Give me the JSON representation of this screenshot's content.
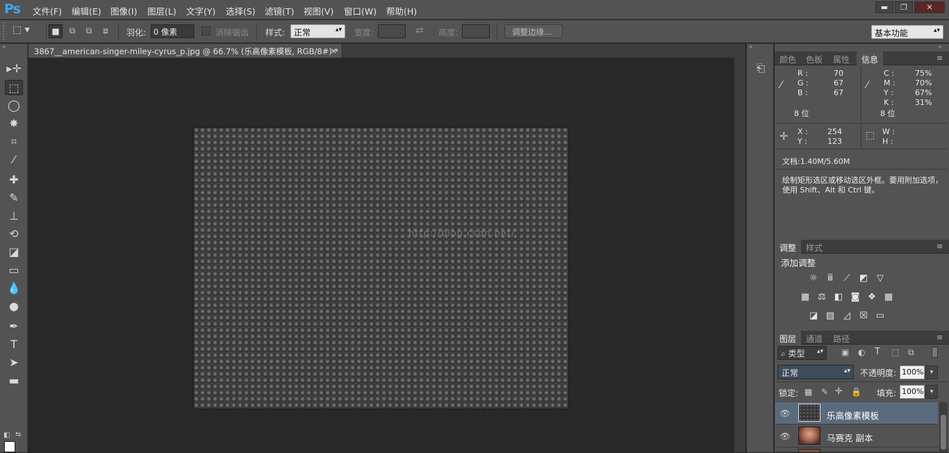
{
  "app": {
    "logo": "Ps",
    "menus": [
      "文件(F)",
      "编辑(E)",
      "图像(I)",
      "图层(L)",
      "文字(Y)",
      "选择(S)",
      "滤镜(T)",
      "视图(V)",
      "窗口(W)",
      "帮助(H)"
    ],
    "window_controls": {
      "minimize": "▬",
      "restore": "❐",
      "close": "✕"
    }
  },
  "options": {
    "feather_label": "羽化:",
    "feather_value": "0 像素",
    "antialias_label": "消除锯齿",
    "style_label": "样式:",
    "style_value": "正常",
    "width_label": "宽度:",
    "height_label": "高度:",
    "refine_edge": "调整边缘...",
    "workspace": "基本功能"
  },
  "document": {
    "tab_title": "3867__american-singer-miley-cyrus_p.jpg @ 66.7% (乐高像素模板, RGB/8#) *",
    "tab_close": "×",
    "watermark": "http://blog.csdn.net/"
  },
  "tools": [
    {
      "name": "move-tool-icon",
      "glyph": "▸✛"
    },
    {
      "name": "rect-marquee-tool-icon",
      "glyph": "⬚"
    },
    {
      "name": "lasso-tool-icon",
      "glyph": "◯"
    },
    {
      "name": "magic-wand-tool-icon",
      "glyph": "✸"
    },
    {
      "name": "crop-tool-icon",
      "glyph": "⌗"
    },
    {
      "name": "eyedropper-tool-icon",
      "glyph": "⁄"
    },
    {
      "name": "healing-brush-tool-icon",
      "glyph": "✚"
    },
    {
      "name": "brush-tool-icon",
      "glyph": "✎"
    },
    {
      "name": "clone-stamp-tool-icon",
      "glyph": "⊥"
    },
    {
      "name": "history-brush-tool-icon",
      "glyph": "⟲"
    },
    {
      "name": "eraser-tool-icon",
      "glyph": "◪"
    },
    {
      "name": "gradient-tool-icon",
      "glyph": "▭"
    },
    {
      "name": "blur-tool-icon",
      "glyph": "💧"
    },
    {
      "name": "dodge-tool-icon",
      "glyph": "●"
    },
    {
      "name": "pen-tool-icon",
      "glyph": "✒"
    },
    {
      "name": "type-tool-icon",
      "glyph": "T"
    },
    {
      "name": "path-selection-tool-icon",
      "glyph": "➤"
    },
    {
      "name": "shape-tool-icon",
      "glyph": "▬"
    },
    {
      "name": "hand-tool-icon",
      "glyph": "✋"
    },
    {
      "name": "zoom-tool-icon",
      "glyph": "🔍"
    }
  ],
  "info_panel": {
    "tabs": [
      "颜色",
      "色板",
      "属性",
      "信息"
    ],
    "rgb": {
      "R": "70",
      "G": "67",
      "B": "67"
    },
    "cmyk": {
      "C": "75%",
      "M": "70%",
      "Y": "67%",
      "K": "31%"
    },
    "bit_left": "8 位",
    "bit_right": "8 位",
    "x": "254",
    "y": "123",
    "w": "",
    "h": "",
    "doc": "文档:1.40M/5.60M",
    "hint": "绘制矩形选区或移动选区外框。要用附加选项，使用 Shift、Alt 和 Ctrl 键。"
  },
  "adjust_panel": {
    "tabs": [
      "调整",
      "样式"
    ],
    "title": "添加调整",
    "row1": [
      "brightness-icon",
      "levels-icon",
      "curves-icon",
      "exposure-icon",
      "vibrance-icon"
    ],
    "row2": [
      "hue-sat-icon",
      "color-balance-icon",
      "black-white-icon",
      "photo-filter-icon",
      "channel-mixer-icon",
      "color-lookup-icon"
    ],
    "row3": [
      "invert-icon",
      "posterize-icon",
      "threshold-icon",
      "selective-color-icon",
      "gradient-map-icon"
    ]
  },
  "layers_panel": {
    "tabs": [
      "图层",
      "通道",
      "路径"
    ],
    "filter_kind": "类型",
    "blend_mode": "正常",
    "opacity_label": "不透明度:",
    "opacity_value": "100%",
    "lock_label": "锁定:",
    "fill_label": "填充:",
    "fill_value": "100%",
    "layers": [
      {
        "name": "乐高像素模板",
        "selected": true
      },
      {
        "name": "马赛克 副本",
        "selected": false
      }
    ]
  }
}
